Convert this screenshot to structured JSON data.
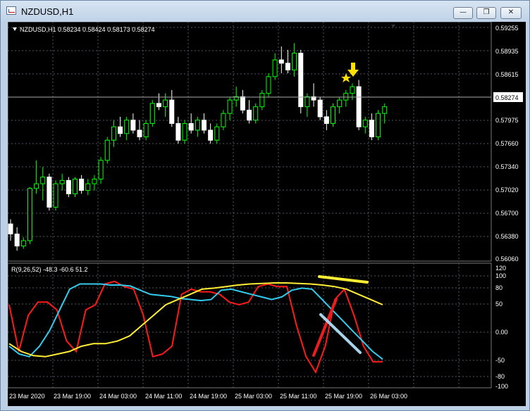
{
  "window": {
    "title": "NZDUSD,H1",
    "min_glyph": "—",
    "max_glyph": "❐",
    "close_glyph": "✕"
  },
  "main_chart": {
    "header": "NZDUSD,H1  0.58234 0.58424 0.58173 0.58274",
    "price_axis": [
      "0.59255",
      "0.58935",
      "0.58615",
      "0.57975",
      "0.57660",
      "0.57340",
      "0.57020",
      "0.56700",
      "0.56380",
      "0.56060"
    ],
    "current_price": "0.58274"
  },
  "indicator": {
    "header": "R(9,26,52) -48.3 -60.6 51.2",
    "axis": [
      "120",
      "100",
      "80",
      "50",
      "0.00",
      "-50",
      "-80",
      "-100"
    ]
  },
  "time_axis": [
    "23 Mar 2020",
    "23 Mar 19:00",
    "24 Mar 03:00",
    "24 Mar 11:00",
    "24 Mar 19:00",
    "25 Mar 03:00",
    "25 Mar 11:00",
    "25 Mar 19:00",
    "26 Mar 03:00"
  ],
  "colors": {
    "bull": "#00ff00",
    "bear": "#ffffff",
    "osc_fast": "#ff1a1a",
    "osc_mid": "#33ccee",
    "osc_slow": "#ffee33",
    "arrow": "#ffe000",
    "annot_red": "#ee1c1c",
    "annot_blue": "#a8d4ea"
  },
  "chart_data": {
    "type": "candlestick",
    "symbol": "NZDUSD",
    "timeframe": "H1",
    "ylim": [
      0.56,
      0.593
    ],
    "candles": [
      [
        0.5645,
        0.5652,
        0.562,
        0.563
      ],
      [
        0.563,
        0.564,
        0.5605,
        0.5612
      ],
      [
        0.5612,
        0.5625,
        0.5608,
        0.562
      ],
      [
        0.562,
        0.57,
        0.5615,
        0.5698
      ],
      [
        0.5698,
        0.574,
        0.569,
        0.5705
      ],
      [
        0.5705,
        0.573,
        0.568,
        0.5715
      ],
      [
        0.5715,
        0.572,
        0.5665,
        0.567
      ],
      [
        0.567,
        0.571,
        0.5665,
        0.5705
      ],
      [
        0.5705,
        0.572,
        0.5695,
        0.571
      ],
      [
        0.571,
        0.5715,
        0.5685,
        0.569
      ],
      [
        0.569,
        0.5715,
        0.5685,
        0.5712
      ],
      [
        0.5712,
        0.5718,
        0.569,
        0.5695
      ],
      [
        0.5695,
        0.5712,
        0.5688,
        0.5705
      ],
      [
        0.5705,
        0.5718,
        0.5695,
        0.5712
      ],
      [
        0.5712,
        0.5745,
        0.5705,
        0.574
      ],
      [
        0.574,
        0.5775,
        0.5735,
        0.577
      ],
      [
        0.577,
        0.58,
        0.576,
        0.579
      ],
      [
        0.579,
        0.5805,
        0.5775,
        0.578
      ],
      [
        0.578,
        0.5805,
        0.577,
        0.58
      ],
      [
        0.58,
        0.581,
        0.578,
        0.5785
      ],
      [
        0.5785,
        0.58,
        0.577,
        0.5775
      ],
      [
        0.5775,
        0.58,
        0.577,
        0.5795
      ],
      [
        0.5795,
        0.583,
        0.579,
        0.5825
      ],
      [
        0.5825,
        0.584,
        0.5815,
        0.582
      ],
      [
        0.582,
        0.584,
        0.5805,
        0.583
      ],
      [
        0.583,
        0.5845,
        0.579,
        0.5795
      ],
      [
        0.5795,
        0.5805,
        0.5765,
        0.577
      ],
      [
        0.577,
        0.58,
        0.5765,
        0.5795
      ],
      [
        0.5795,
        0.581,
        0.578,
        0.5785
      ],
      [
        0.5785,
        0.5805,
        0.5775,
        0.58
      ],
      [
        0.58,
        0.581,
        0.578,
        0.5785
      ],
      [
        0.5785,
        0.5795,
        0.5765,
        0.577
      ],
      [
        0.577,
        0.5795,
        0.5765,
        0.579
      ],
      [
        0.579,
        0.5815,
        0.5785,
        0.581
      ],
      [
        0.581,
        0.5835,
        0.58,
        0.583
      ],
      [
        0.583,
        0.585,
        0.582,
        0.5835
      ],
      [
        0.5835,
        0.5845,
        0.581,
        0.5815
      ],
      [
        0.5815,
        0.583,
        0.5795,
        0.58
      ],
      [
        0.58,
        0.5825,
        0.5795,
        0.582
      ],
      [
        0.582,
        0.5845,
        0.5815,
        0.584
      ],
      [
        0.584,
        0.587,
        0.5835,
        0.5865
      ],
      [
        0.5865,
        0.59,
        0.586,
        0.589
      ],
      [
        0.589,
        0.591,
        0.587,
        0.5885
      ],
      [
        0.5885,
        0.5905,
        0.587,
        0.5875
      ],
      [
        0.5875,
        0.5915,
        0.5865,
        0.59
      ],
      [
        0.59,
        0.5905,
        0.581,
        0.582
      ],
      [
        0.582,
        0.584,
        0.5805,
        0.5835
      ],
      [
        0.5835,
        0.5855,
        0.582,
        0.583
      ],
      [
        0.583,
        0.5835,
        0.58,
        0.5805
      ],
      [
        0.5805,
        0.5815,
        0.5785,
        0.5795
      ],
      [
        0.5795,
        0.5825,
        0.579,
        0.582
      ],
      [
        0.582,
        0.5835,
        0.581,
        0.583
      ],
      [
        0.583,
        0.5845,
        0.582,
        0.584
      ],
      [
        0.584,
        0.5855,
        0.583,
        0.585
      ],
      [
        0.585,
        0.586,
        0.5785,
        0.579
      ],
      [
        0.579,
        0.5805,
        0.578,
        0.58
      ],
      [
        0.58,
        0.581,
        0.577,
        0.5775
      ],
      [
        0.5775,
        0.5815,
        0.577,
        0.581
      ],
      [
        0.581,
        0.5825,
        0.5795,
        0.582
      ]
    ],
    "oscillator": {
      "header": "R(9,26,52)",
      "ylim": [
        -110,
        130
      ],
      "series": [
        {
          "values": [
            50,
            -40,
            30,
            55,
            55,
            40,
            -20,
            -40,
            40,
            50,
            90,
            95,
            85,
            80,
            30,
            -50,
            -45,
            -30,
            70,
            80,
            75,
            75,
            70,
            55,
            50,
            55,
            85,
            90,
            85,
            85,
            10,
            -50,
            -80,
            -30,
            60,
            80,
            30,
            -30,
            -60,
            -60
          ]
        },
        {
          "values": [
            -30,
            -45,
            -50,
            -30,
            0,
            40,
            80,
            90,
            90,
            90,
            88,
            88,
            86,
            78,
            70,
            68,
            66,
            62,
            60,
            58,
            60,
            78,
            80,
            75,
            70,
            65,
            60,
            65,
            78,
            82,
            80,
            60,
            40,
            20,
            0,
            -20,
            -40,
            -55
          ]
        },
        {
          "values": [
            -25,
            -40,
            -48,
            -50,
            -45,
            -40,
            -30,
            -25,
            -25,
            -20,
            -10,
            10,
            30,
            50,
            60,
            70,
            80,
            82,
            85,
            88,
            90,
            91,
            92,
            92,
            91,
            90,
            88,
            85,
            80,
            70,
            60,
            50
          ]
        }
      ]
    }
  }
}
